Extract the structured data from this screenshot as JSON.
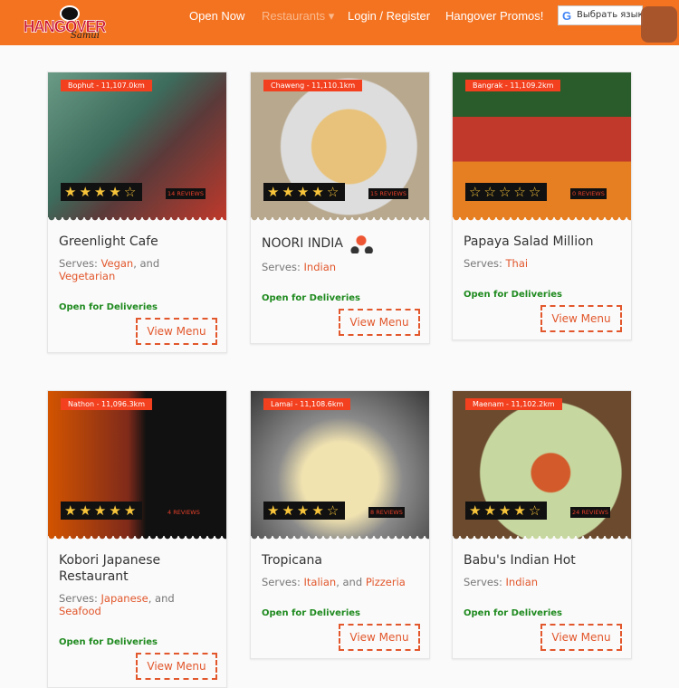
{
  "nav": {
    "logo_text": "HANGOVER",
    "logo_sub": "Samui",
    "links": [
      {
        "label": "Open Now"
      },
      {
        "label": "Restaurants ▾",
        "active": true
      },
      {
        "label": "Login / Register"
      },
      {
        "label": "Hangover Promos!"
      }
    ],
    "language": "Выбрать язык",
    "cart_icon": "basket-icon"
  },
  "colors": {
    "brand": "#f47321",
    "accent": "#e2572c",
    "open": "#1f8a1f"
  },
  "restaurants": [
    {
      "name": "Greenlight Cafe",
      "location": "Bophut - 11,107.0km",
      "rating": 4,
      "reviews": "14 REVIEWS",
      "serves_label": "Serves: ",
      "cuisines": [
        "Vegan",
        "Vegetarian"
      ],
      "status": "Open for Deliveries",
      "button": "View Menu",
      "img": "linear-gradient(135deg,#6a9b86,#3d6b5c 40%,#5b3a3a 60%,#c0392b)"
    },
    {
      "name": "NOORI INDIA",
      "location": "Chaweng - 11,110.1km",
      "rating": 4,
      "reviews": "15 REVIEWS",
      "serves_label": "Serves: ",
      "cuisines": [
        "Indian"
      ],
      "status": "Open for Deliveries",
      "button": "View Menu",
      "delivery_icon": true,
      "img": "radial-gradient(circle at 55% 50%,#e8c27a 0 30%,#ddd 31% 55%,#b8a88e 56%)"
    },
    {
      "name": "Papaya Salad Million",
      "location": "Bangrak - 11,109.2km",
      "rating": 0,
      "reviews": "0 REVIEWS",
      "serves_label": "Serves: ",
      "cuisines": [
        "Thai"
      ],
      "status": "Open for Deliveries",
      "button": "View Menu",
      "img": "linear-gradient(180deg,#2a5b2a 0 30%,#c0392b 30% 60%,#e67e22 60%)"
    },
    {
      "name": "Kobori Japanese Restaurant",
      "location": "Nathon - 11,096.3km",
      "rating": 5,
      "reviews": "4 REVIEWS",
      "serves_label": "Serves: ",
      "cuisines": [
        "Japanese",
        "Seafood"
      ],
      "status": "Open for Deliveries",
      "button": "View Menu",
      "img": "linear-gradient(90deg,#d35400,#7f2a1a 45%,#111 55%,#111)"
    },
    {
      "name": "Tropicana",
      "location": "Lamai - 11,108.6km",
      "rating": 4,
      "reviews": "8 REVIEWS",
      "serves_label": "Serves: ",
      "cuisines": [
        "Italian",
        "Pizzeria"
      ],
      "status": "Open for Deliveries",
      "button": "View Menu",
      "img": "radial-gradient(circle at 50% 60%,#f1e3b0 0 30%,#8a8a8a 50%,#3a3a3a)"
    },
    {
      "name": "Babu's Indian Hot",
      "location": "Maenam - 11,102.2km",
      "rating": 4,
      "reviews": "24 REVIEWS",
      "serves_label": "Serves: ",
      "cuisines": [
        "Indian"
      ],
      "status": "Open for Deliveries",
      "button": "View Menu",
      "img": "radial-gradient(circle at 55% 55%,#d35a2a 0 15%,#c7d7a0 16% 55%,#6b4a2e 56%)"
    }
  ]
}
